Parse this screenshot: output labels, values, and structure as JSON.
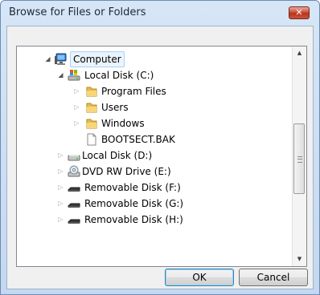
{
  "window": {
    "title": "Browse for Files or Folders",
    "close_glyph": "✕"
  },
  "tree": {
    "items": [
      {
        "label": "Computer",
        "icon": "computer-icon",
        "state": "expanded",
        "selected": true
      },
      {
        "label": "Local Disk (C:)",
        "icon": "system-drive-icon",
        "state": "expanded"
      },
      {
        "label": "Program Files",
        "icon": "folder-icon",
        "state": "collapsed"
      },
      {
        "label": "Users",
        "icon": "folder-icon",
        "state": "collapsed"
      },
      {
        "label": "Windows",
        "icon": "folder-icon",
        "state": "collapsed"
      },
      {
        "label": "BOOTSECT.BAK",
        "icon": "file-icon",
        "state": "none"
      },
      {
        "label": "Local Disk (D:)",
        "icon": "hard-drive-icon",
        "state": "collapsed"
      },
      {
        "label": "DVD RW Drive (E:)",
        "icon": "dvd-drive-icon",
        "state": "collapsed"
      },
      {
        "label": "Removable Disk (F:)",
        "icon": "removable-disk-icon",
        "state": "collapsed"
      },
      {
        "label": "Removable Disk (G:)",
        "icon": "removable-disk-icon",
        "state": "collapsed"
      },
      {
        "label": "Removable Disk (H:)",
        "icon": "removable-disk-icon",
        "state": "collapsed"
      }
    ]
  },
  "buttons": {
    "ok": "OK",
    "cancel": "Cancel"
  },
  "glyphs": {
    "expanded": "◢",
    "collapsed": "▷",
    "up": "▲",
    "down": "▼"
  }
}
